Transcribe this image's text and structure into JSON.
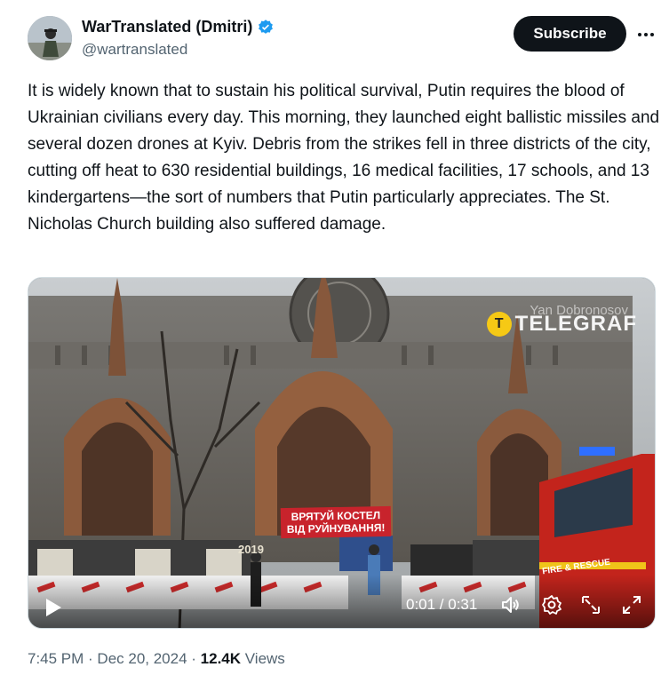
{
  "author": {
    "display_name": "WarTranslated (Dmitri)",
    "handle": "@wartranslated",
    "verified_icon": "verified-badge-icon",
    "avatar_icon": "avatar"
  },
  "header": {
    "subscribe_label": "Subscribe",
    "more_icon": "more-dots-icon"
  },
  "tweet": {
    "text": "It is widely known that to sustain his political survival, Putin requires the blood of Ukrainian civilians every day. This morning, they launched eight ballistic missiles and several dozen drones at Kyiv. Debris from the strikes fell in three districts of the city, cutting off heat to 630 residential buildings, 16 medical facilities, 17 schools, and 13 kindergartens—the sort of numbers that Putin particularly appreciates. The St. Nicholas Church building also suffered damage."
  },
  "media": {
    "watermark_credit": "Yan Dobronosov",
    "watermark_brand": "TELEGRAF",
    "sign_text_line1": "ВРЯТУЙ КОСТЕЛ",
    "sign_text_line2": "ВІД РУЙНУВАННЯ!",
    "banner_year": "2019",
    "truck_text": "FIRE & RESCUE",
    "time_display": "0:01 / 0:31",
    "progress": 0.03,
    "icons": [
      "play-icon",
      "volume-icon",
      "settings-icon",
      "pip-icon",
      "fullscreen-icon"
    ]
  },
  "meta": {
    "time": "7:45 PM",
    "separator": " · ",
    "date": "Dec 20, 2024",
    "views_count": "12.4K",
    "views_label": " Views"
  },
  "colors": {
    "text": "#0f1419",
    "secondary": "#536471",
    "verified": "#1d9bf0",
    "button_bg": "#0f1419"
  }
}
